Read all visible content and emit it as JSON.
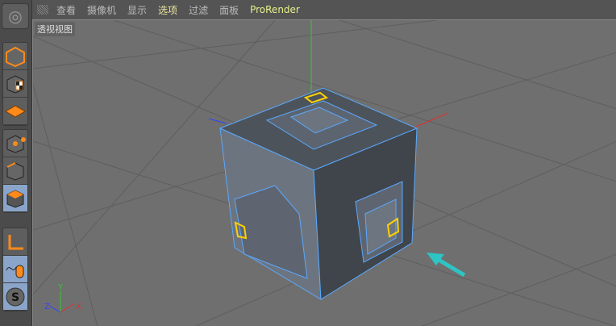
{
  "menu": [
    "查看",
    "摄像机",
    "显示",
    "选项",
    "过滤",
    "面板",
    "ProRender"
  ],
  "viewport": {
    "label": "透视视图"
  },
  "axes": {
    "x": "X",
    "y": "Y",
    "z": "Z"
  },
  "tools": [
    "model-mode",
    "texture-mode",
    "workplane-mode",
    "point-mode",
    "edge-mode",
    "polygon-mode",
    "axis-mode",
    "tweak-mode",
    "snap-toggle"
  ],
  "colors": {
    "accent": "#ff8a1a",
    "selected": "#8aa5c9",
    "edge": "#5aa9ff",
    "selection": "#ffd200",
    "arrow": "#2ec4c4"
  }
}
